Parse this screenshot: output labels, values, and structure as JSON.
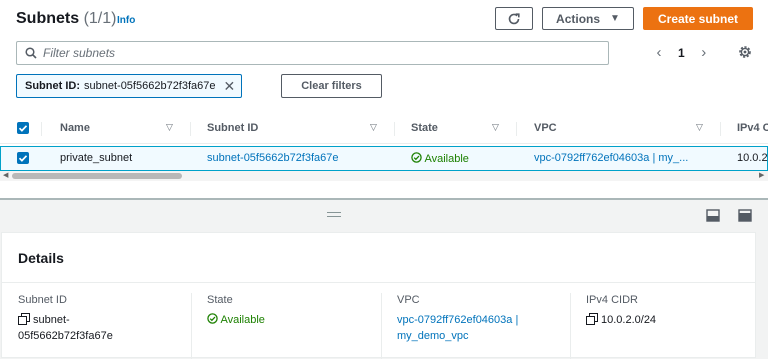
{
  "header": {
    "title": "Subnets",
    "count": "(1/1)",
    "info_label": "Info",
    "actions_label": "Actions",
    "create_label": "Create subnet"
  },
  "search": {
    "placeholder": "Filter subnets"
  },
  "pagination": {
    "current_page": "1"
  },
  "filter_token": {
    "key": "Subnet ID:",
    "value": "subnet-05f5662b72f3fa67e"
  },
  "clear_filters_label": "Clear filters",
  "table": {
    "columns": [
      "Name",
      "Subnet ID",
      "State",
      "VPC",
      "IPv4 C"
    ],
    "rows": [
      {
        "selected": true,
        "name": "private_subnet",
        "subnet_id": "subnet-05f5662b72f3fa67e",
        "state": "Available",
        "vpc": "vpc-0792ff762ef04603a | my_...",
        "ipv4": "10.0.2"
      }
    ]
  },
  "details": {
    "title": "Details",
    "fields": [
      {
        "label": "Subnet ID",
        "value_line1": "subnet-",
        "value_line2": "05f5662b72f3fa67e"
      },
      {
        "label": "State",
        "value": "Available"
      },
      {
        "label": "VPC",
        "value_line1": "vpc-0792ff762ef04603a |",
        "value_line2": "my_demo_vpc"
      },
      {
        "label": "IPv4 CIDR",
        "value": "10.0.2.0/24"
      }
    ]
  },
  "icons": [
    "refresh-icon",
    "caret-down-icon",
    "search-icon",
    "chevron-left-icon",
    "chevron-right-icon",
    "gear-icon",
    "close-icon",
    "sort-icon",
    "checkbox-checked-icon",
    "status-ok-icon",
    "copy-icon",
    "drag-handle-icon",
    "split-panel-bottom-icon",
    "split-panel-side-icon"
  ],
  "colors": {
    "accent": "#0073bb",
    "primary_button": "#ec7211",
    "success": "#1d8102",
    "selected_row": "#f1faff"
  }
}
